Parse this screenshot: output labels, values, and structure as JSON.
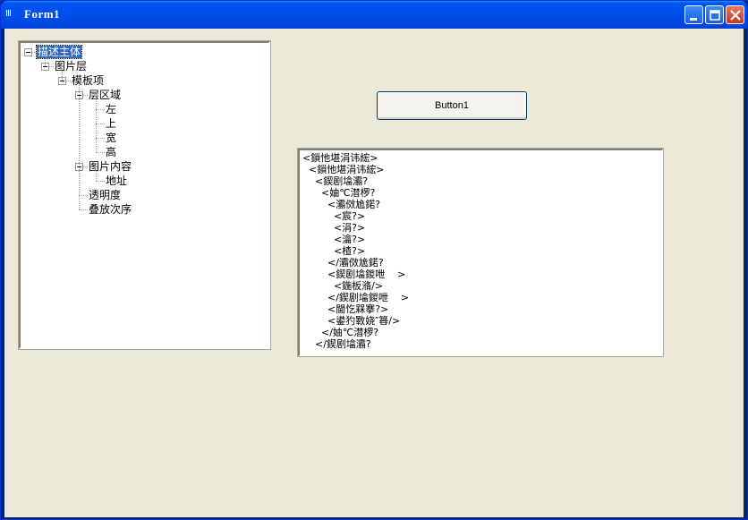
{
  "window": {
    "title": "Form1",
    "icon_text": "Ⅲ"
  },
  "tree": {
    "nodes": [
      {
        "label": "描述主体",
        "level": 0,
        "expander": true,
        "selected": true
      },
      {
        "label": "图片层",
        "level": 1,
        "expander": true
      },
      {
        "label": "模板项",
        "level": 2,
        "expander": true
      },
      {
        "label": "层区域",
        "level": 3,
        "expander": true
      },
      {
        "label": "左",
        "level": 4,
        "expander": false
      },
      {
        "label": "上",
        "level": 4,
        "expander": false
      },
      {
        "label": "宽",
        "level": 4,
        "expander": false
      },
      {
        "label": "高",
        "level": 4,
        "expander": false
      },
      {
        "label": "图片内容",
        "level": 3,
        "expander": true
      },
      {
        "label": "地址",
        "level": 4,
        "expander": false
      },
      {
        "label": "透明度",
        "level": 3,
        "expander": false
      },
      {
        "label": "叠放次序",
        "level": 3,
        "expander": false
      }
    ]
  },
  "button1": {
    "label": "Button1"
  },
  "textbox": {
    "lines": [
      "<鎻忚堪涓讳綋>",
      "  <鎻忚堪涓讳綋>",
      "    <鍥剧墖灞?",
      "      <妯℃澘椤?",
      "        <灞傚尯鍩?",
      "          <宸?>",
      "          <涓?>",
      "          <瀹?>",
      "          <楂?>",
      "        </灞傚尯鍩?",
      "        <鍥剧墖鍐呭    >",
      "          <鍦板潃/>",
      "        </鍥剧墖鍐呭    >",
      "        <閫忔槑搴?>",
      "        <鍙犳斁娆″簭/>",
      "      </妯℃澘椤?",
      "    </鍥剧墖灞?"
    ]
  }
}
